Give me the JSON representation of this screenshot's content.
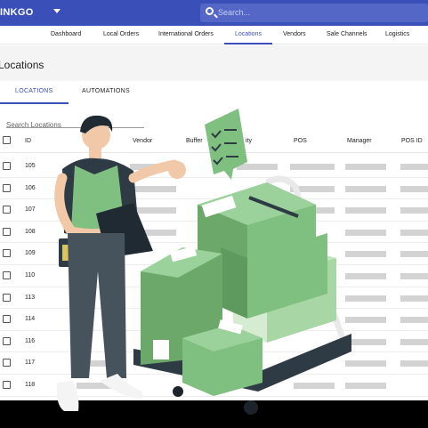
{
  "app": {
    "brand": "INKGO"
  },
  "search": {
    "placeholder": "Search..."
  },
  "nav": {
    "items": [
      {
        "label": "Dashboard"
      },
      {
        "label": "Local Orders"
      },
      {
        "label": "International Orders"
      },
      {
        "label": "Locations"
      },
      {
        "label": "Vendors"
      },
      {
        "label": "Sale Channels"
      },
      {
        "label": "Logistics"
      }
    ],
    "active": "Locations"
  },
  "page": {
    "title": "Locations"
  },
  "tabs": [
    {
      "label": "LOCATIONS"
    },
    {
      "label": "AUTOMATIONS"
    }
  ],
  "locations_search": {
    "placeholder": "Search Locations"
  },
  "table": {
    "headers": [
      "ID",
      "Vendor",
      "Buffer",
      "Quantity",
      "POS",
      "Manager",
      "POS ID"
    ],
    "visible_header_text": {
      "quantity": "ity"
    },
    "rows": [
      {
        "id": "105"
      },
      {
        "id": "106"
      },
      {
        "id": "107"
      },
      {
        "id": "108"
      },
      {
        "id": "109"
      },
      {
        "id": "110"
      },
      {
        "id": "113"
      },
      {
        "id": "114"
      },
      {
        "id": "116"
      },
      {
        "id": "117"
      },
      {
        "id": "118"
      }
    ]
  },
  "colors": {
    "primary": "#3a4fb7",
    "box_green": "#7fbf7f",
    "box_green_dark": "#5e9a5e",
    "box_green_light": "#a9d6a5"
  }
}
